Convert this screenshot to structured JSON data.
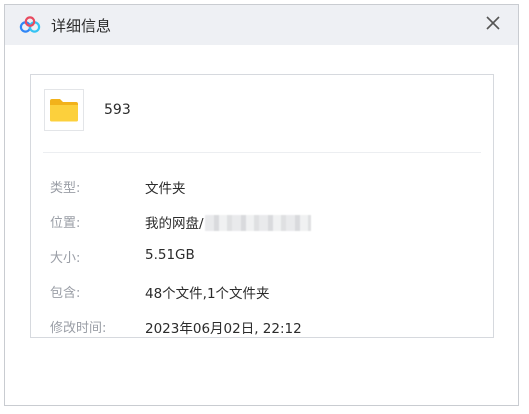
{
  "window": {
    "title": "详细信息",
    "accent_color": "#3b8cf0"
  },
  "file": {
    "name": "593",
    "icon": "folder-icon"
  },
  "details": [
    {
      "label": "类型:",
      "value": "文件夹"
    },
    {
      "label": "位置:",
      "value": "我的网盘/"
    },
    {
      "label": "大小:",
      "value": "5.51GB"
    },
    {
      "label": "包含:",
      "value": "48个文件,1个文件夹"
    },
    {
      "label": "修改时间:",
      "value": "2023年06月02日, 22:12"
    }
  ]
}
